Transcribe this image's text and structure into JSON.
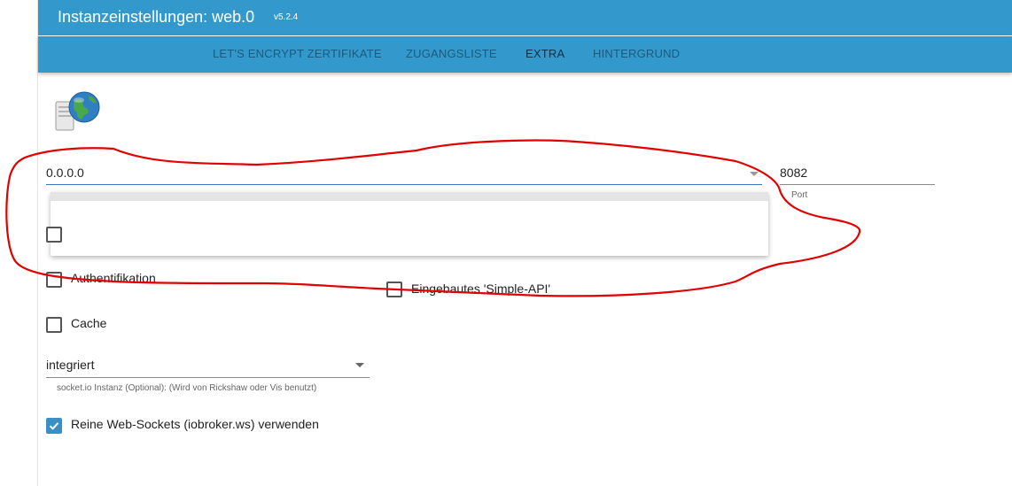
{
  "header": {
    "title": "Instanzeinstellungen: web.0",
    "version": "v5.2.4"
  },
  "tabs": [
    {
      "label": "LET'S ENCRYPT ZERTIFIKATE",
      "active": false
    },
    {
      "label": "ZUGANGSLISTE",
      "active": false
    },
    {
      "label": "EXTRA",
      "active": true
    },
    {
      "label": "HINTERGRUND",
      "active": false
    }
  ],
  "logo": {
    "icon": "server-globe-icon"
  },
  "ip_select": {
    "value": "0.0.0.0"
  },
  "port": {
    "value": "8082",
    "label": "Port"
  },
  "checkboxes": {
    "auth": {
      "label": "Authentifikation",
      "checked": false
    },
    "simple_api": {
      "label": "Eingebautes 'Simple-API'",
      "checked": false
    },
    "cache": {
      "label": "Cache",
      "checked": false
    },
    "pure_sockets": {
      "label": "Reine Web-Sockets (iobroker.ws) verwenden",
      "checked": true
    }
  },
  "socket_select": {
    "value": "integriert",
    "helper": "socket.io Instanz (Optional): (Wird von Rickshaw oder Vis benutzt)"
  },
  "colors": {
    "accent": "#3399cc",
    "annotation": "#e00000",
    "checkbox_checked": "#3a8fc4"
  }
}
